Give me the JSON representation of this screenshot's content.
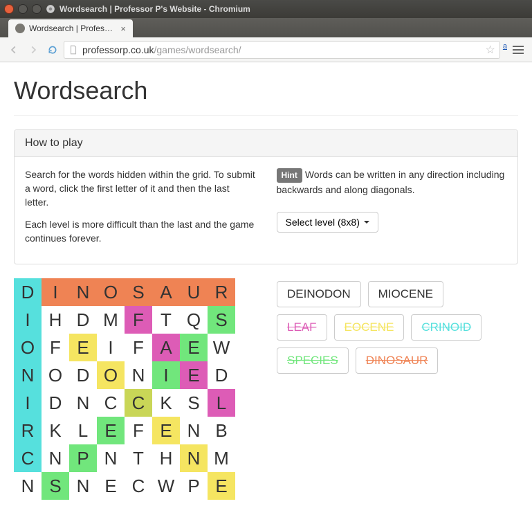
{
  "browser": {
    "window_title": "Wordsearch | Professor P's Website - Chromium",
    "tab_title": "Wordsearch | Professor P's Website",
    "url_host": "professorp.co.uk",
    "url_path": "/games/wordsearch/"
  },
  "page": {
    "title": "Wordsearch"
  },
  "panel": {
    "heading": "How to play",
    "p1": "Search for the words hidden within the grid. To submit a word, click the first letter of it and then the last letter.",
    "p2": "Each level is more difficult than the last and the game continues forever.",
    "hint_badge": "Hint",
    "hint_text": "Words can be written in any direction including backwards and along diagonals.",
    "select_label": "Select level (8x8)"
  },
  "colors": {
    "orange": "#ef8354",
    "teal": "#56e0dd",
    "magenta": "#dd5cb6",
    "yellow": "#f5e561",
    "green": "#71e67c",
    "yellowgreen": "#c9d657"
  },
  "grid": [
    [
      {
        "l": "D",
        "c": "teal"
      },
      {
        "l": "I",
        "c": "orange"
      },
      {
        "l": "N",
        "c": "orange"
      },
      {
        "l": "O",
        "c": "orange"
      },
      {
        "l": "S",
        "c": "orange"
      },
      {
        "l": "A",
        "c": "orange"
      },
      {
        "l": "U",
        "c": "orange"
      },
      {
        "l": "R",
        "c": "orange"
      }
    ],
    [
      {
        "l": "I",
        "c": "teal"
      },
      {
        "l": "H",
        "c": null
      },
      {
        "l": "D",
        "c": null
      },
      {
        "l": "M",
        "c": null
      },
      {
        "l": "F",
        "c": "magenta"
      },
      {
        "l": "T",
        "c": null
      },
      {
        "l": "Q",
        "c": null
      },
      {
        "l": "S",
        "c": "green"
      }
    ],
    [
      {
        "l": "O",
        "c": "teal"
      },
      {
        "l": "F",
        "c": null
      },
      {
        "l": "E",
        "c": "yellow"
      },
      {
        "l": "I",
        "c": null
      },
      {
        "l": "F",
        "c": null
      },
      {
        "l": "A",
        "c": "magenta"
      },
      {
        "l": "E",
        "c": "green"
      },
      {
        "l": "W",
        "c": null
      }
    ],
    [
      {
        "l": "N",
        "c": "teal"
      },
      {
        "l": "O",
        "c": null
      },
      {
        "l": "D",
        "c": null
      },
      {
        "l": "O",
        "c": "yellow"
      },
      {
        "l": "N",
        "c": null
      },
      {
        "l": "I",
        "c": "green"
      },
      {
        "l": "E",
        "c": "magenta"
      },
      {
        "l": "D",
        "c": null
      }
    ],
    [
      {
        "l": "I",
        "c": "teal"
      },
      {
        "l": "D",
        "c": null
      },
      {
        "l": "N",
        "c": null
      },
      {
        "l": "C",
        "c": null
      },
      {
        "l": "C",
        "c": "yellowgreen"
      },
      {
        "l": "K",
        "c": null
      },
      {
        "l": "S",
        "c": null
      },
      {
        "l": "L",
        "c": "magenta"
      }
    ],
    [
      {
        "l": "R",
        "c": "teal"
      },
      {
        "l": "K",
        "c": null
      },
      {
        "l": "L",
        "c": null
      },
      {
        "l": "E",
        "c": "green"
      },
      {
        "l": "F",
        "c": null
      },
      {
        "l": "E",
        "c": "yellow"
      },
      {
        "l": "N",
        "c": null
      },
      {
        "l": "B",
        "c": null
      }
    ],
    [
      {
        "l": "C",
        "c": "teal"
      },
      {
        "l": "N",
        "c": null
      },
      {
        "l": "P",
        "c": "green"
      },
      {
        "l": "N",
        "c": null
      },
      {
        "l": "T",
        "c": null
      },
      {
        "l": "H",
        "c": null
      },
      {
        "l": "N",
        "c": "yellow"
      },
      {
        "l": "M",
        "c": null
      }
    ],
    [
      {
        "l": "N",
        "c": null
      },
      {
        "l": "S",
        "c": "green"
      },
      {
        "l": "N",
        "c": null
      },
      {
        "l": "E",
        "c": null
      },
      {
        "l": "C",
        "c": null
      },
      {
        "l": "W",
        "c": null
      },
      {
        "l": "P",
        "c": null
      },
      {
        "l": "E",
        "c": "yellow"
      }
    ]
  ],
  "words": [
    {
      "label": "DEINODON",
      "found": false,
      "color": null
    },
    {
      "label": "MIOCENE",
      "found": false,
      "color": null
    },
    {
      "label": "LEAF",
      "found": true,
      "color": "magenta"
    },
    {
      "label": "EOCENE",
      "found": true,
      "color": "yellow"
    },
    {
      "label": "CRINOID",
      "found": true,
      "color": "teal"
    },
    {
      "label": "SPECIES",
      "found": true,
      "color": "green"
    },
    {
      "label": "DINOSAUR",
      "found": true,
      "color": "orange"
    }
  ]
}
